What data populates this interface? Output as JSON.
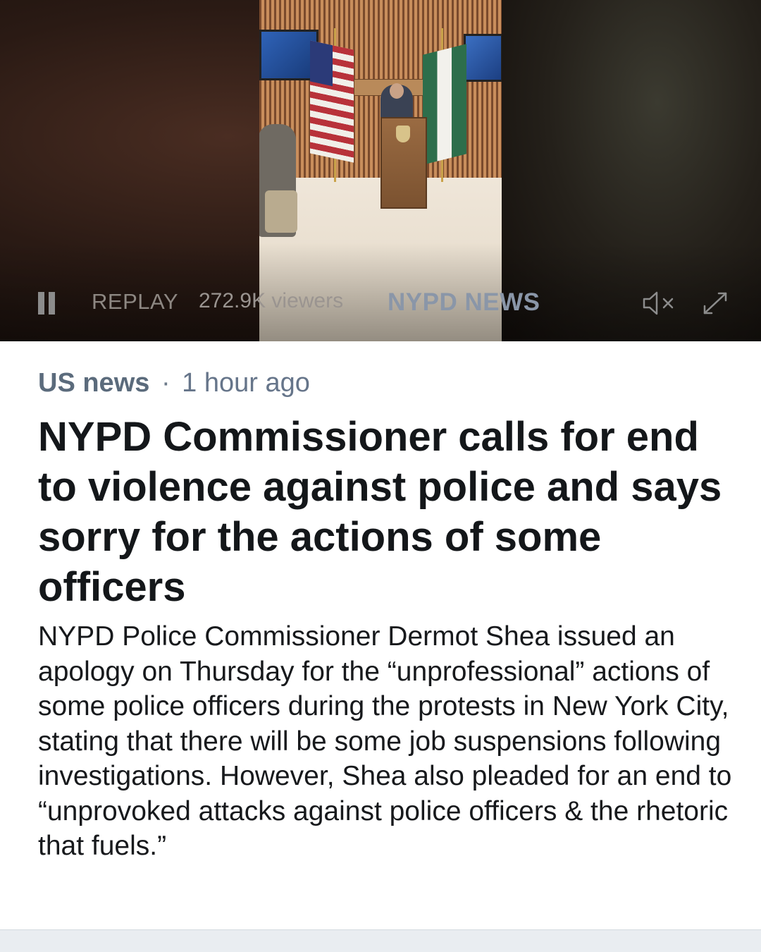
{
  "video": {
    "replay_label": "REPLAY",
    "viewers_label": "272.9K viewers",
    "channel_name": "NYPD NEWS",
    "icons": {
      "pause": "pause-icon",
      "mute": "speaker-muted-icon",
      "expand": "expand-arrows-icon"
    }
  },
  "article": {
    "category": "US news",
    "separator": "·",
    "time_ago": "1 hour ago",
    "headline": "NYPD Commissioner calls for end to violence against police and says sorry for the actions of some officers",
    "body": "NYPD Police Commissioner Dermot Shea issued an apology on Thursday for the “unprofessional” actions of some police officers during the protests in New York City, stating that there will be some job suspensions following investigations. However, Shea also pleaded for an end to “unprovoked attacks against police officers & the rhetoric that fuels.”"
  },
  "colors": {
    "headline": "#14171a",
    "meta": "#5f6e80",
    "channel_label": "#8a96a8",
    "bottom_bar": "#e9edf1"
  }
}
